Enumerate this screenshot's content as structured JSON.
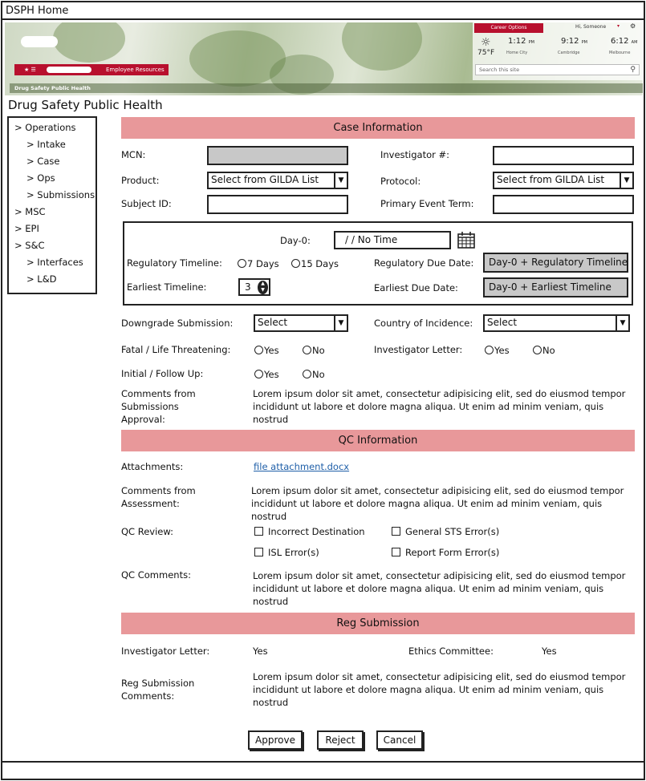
{
  "window": {
    "title": "DSPH Home"
  },
  "banner": {
    "nav_icons": "★ ☰",
    "employee_resources": "Employee Resources",
    "subtitle": "Drug Safety Public Health",
    "career_button": "Career Options",
    "greeting": "Hi, Someone",
    "weather": {
      "icon": "sun-icon",
      "temp": "75°F"
    },
    "clocks": [
      {
        "time": "1:12",
        "ampm": "PM",
        "city": "Home City"
      },
      {
        "time": "9:12",
        "ampm": "PM",
        "city": "Cambridge"
      },
      {
        "time": "6:12",
        "ampm": "AM",
        "city": "Melbourne"
      }
    ],
    "search_placeholder": "Search this site",
    "colors": {
      "brand_red": "#b8102e"
    }
  },
  "app": {
    "title": "Drug Safety Public Health"
  },
  "sidebar": {
    "items": [
      {
        "label": "> Operations"
      },
      {
        "label": "> Intake"
      },
      {
        "label": "> Case"
      },
      {
        "label": "> Ops"
      },
      {
        "label": "> Submissions"
      },
      {
        "label": "> MSC"
      },
      {
        "label": "> EPI"
      },
      {
        "label": "> S&C"
      },
      {
        "label": "> Interfaces"
      },
      {
        "label": "> L&D"
      }
    ]
  },
  "case_info": {
    "header": "Case Information",
    "mcn_label": "MCN:",
    "investigator_num_label": "Investigator #:",
    "product_label": "Product:",
    "product_value": "Select from GILDA List",
    "protocol_label": "Protocol:",
    "protocol_value": "Select from GILDA List",
    "subject_id_label": "Subject ID:",
    "primary_event_label": "Primary Event Term:"
  },
  "timeline": {
    "day0_label": "Day-0:",
    "day0_value": "/  /     No Time",
    "reg_timeline_label": "Regulatory Timeline:",
    "opt_7": "7 Days",
    "opt_15": "15 Days",
    "reg_due_label": "Regulatory Due Date:",
    "reg_due_value": "Day-0 + Regulatory Timeline",
    "earliest_timeline_label": "Earliest Timeline:",
    "earliest_timeline_value": "3",
    "earliest_due_label": "Earliest Due Date:",
    "earliest_due_value": "Day-0 + Earliest Timeline"
  },
  "submission": {
    "downgrade_label": "Downgrade Submission:",
    "downgrade_value": "Select",
    "country_label": "Country of Incidence:",
    "country_value": "Select",
    "fatal_label": "Fatal / Life Threatening:",
    "investigator_letter_label": "Investigator Letter:",
    "initial_label": "Initial / Follow Up:",
    "yes": "Yes",
    "no": "No",
    "comments_label_1": "Comments from",
    "comments_label_2": "Submissions",
    "comments_label_3": "Approval:",
    "comments_text": "Lorem ipsum dolor sit amet, consectetur adipisicing elit, sed do eiusmod tempor incididunt ut labore et dolore magna aliqua. Ut enim ad minim veniam, quis nostrud"
  },
  "qc": {
    "header": "QC Information",
    "attachments_label": "Attachments:",
    "attachment_file": "file attachment.docx",
    "assessment_label_1": "Comments from",
    "assessment_label_2": "Assessment:",
    "assessment_text": "Lorem ipsum dolor sit amet, consectetur adipisicing elit, sed do eiusmod tempor incididunt ut labore et dolore magna aliqua. Ut enim ad minim veniam, quis nostrud",
    "review_label": "QC Review:",
    "checks": [
      "Incorrect Destination",
      "General STS Error(s)",
      "ISL Error(s)",
      "Report Form Error(s)"
    ],
    "comments_label": "QC Comments:",
    "comments_text": "Lorem ipsum dolor sit amet, consectetur adipisicing elit, sed do eiusmod tempor incididunt ut labore et dolore magna aliqua. Ut enim ad minim veniam, quis nostrud"
  },
  "reg": {
    "header": "Reg Submission",
    "investigator_letter_label": "Investigator Letter:",
    "investigator_letter_value": "Yes",
    "ethics_label": "Ethics Committee:",
    "ethics_value": "Yes",
    "comments_label_1": "Reg Submission",
    "comments_label_2": "Comments:",
    "comments_text": "Lorem ipsum dolor sit amet, consectetur adipisicing elit, sed do eiusmod tempor incididunt ut labore et dolore magna aliqua. Ut enim ad minim veniam, quis nostrud"
  },
  "actions": {
    "approve": "Approve",
    "reject": "Reject",
    "cancel": "Cancel"
  }
}
